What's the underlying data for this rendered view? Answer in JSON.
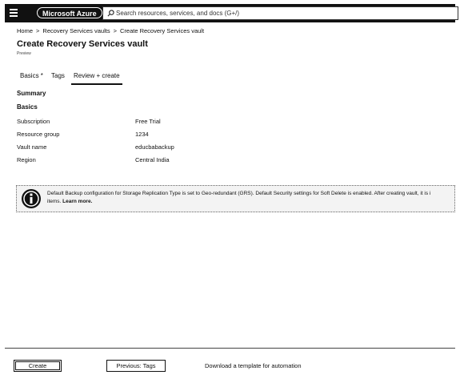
{
  "topbar": {
    "brand": "Microsoft Azure",
    "search_placeholder": "Search resources, services, and docs (G+/)"
  },
  "breadcrumb": {
    "items": [
      "Home",
      "Recovery Services vaults",
      "Create Recovery Services vault"
    ],
    "separator": ">"
  },
  "page": {
    "title": "Create Recovery Services vault",
    "subtitle": "Preview"
  },
  "tabs": [
    {
      "label": "Basics",
      "marker": "*"
    },
    {
      "label": "Tags"
    },
    {
      "label": "Review + create",
      "active": true
    }
  ],
  "summary": {
    "heading": "Summary",
    "section": "Basics",
    "fields": [
      {
        "label": "Subscription",
        "value": "Free Trial"
      },
      {
        "label": "Resource group",
        "value": "1234"
      },
      {
        "label": "Vault name",
        "value": "educbabackup"
      },
      {
        "label": "Region",
        "value": "Central India"
      }
    ]
  },
  "info": {
    "icon": "info-icon",
    "line1": "Default Backup configuration for Storage Replication Type is set to Geo-redundant (GRS). Default Security settings for Soft Delete is enabled. After creating vault, it is i",
    "line2_prefix": "items.",
    "line2_link": "Learn more."
  },
  "footer": {
    "create_label": "Create",
    "previous_label": "Previous: Tags",
    "download_label": "Download a template for automation"
  }
}
